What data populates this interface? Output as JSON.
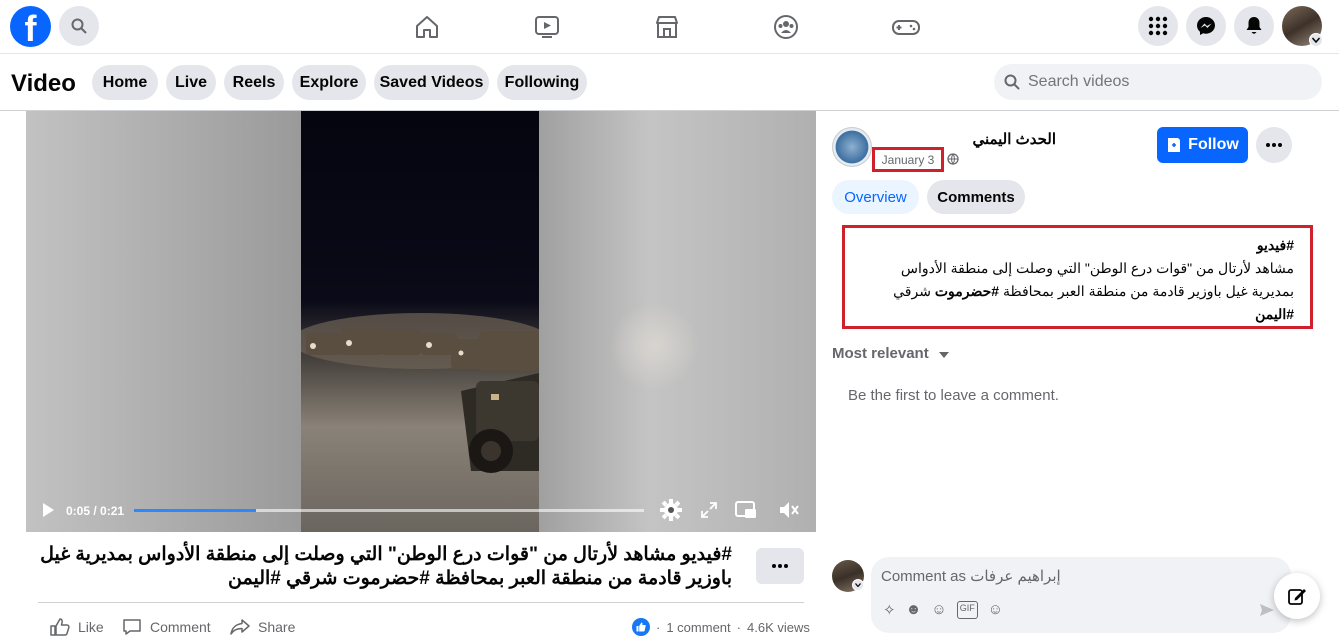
{
  "app": {
    "logo_letter": "f",
    "brand_color": "#0866ff"
  },
  "topnav": {
    "icons": [
      "home-icon",
      "watch-icon",
      "marketplace-icon",
      "groups-icon",
      "gaming-icon"
    ],
    "right_icons": [
      "menu-grid-icon",
      "messenger-icon",
      "notifications-icon",
      "profile-avatar"
    ]
  },
  "video_header": {
    "title": "Video",
    "tabs": [
      "Home",
      "Live",
      "Reels",
      "Explore",
      "Saved Videos",
      "Following"
    ],
    "search_placeholder": "Search videos"
  },
  "player": {
    "time": "0:05 / 0:21",
    "progress_fraction": 0.24
  },
  "caption": "#فيديو مشاهد لأرتال من \"قوات درع الوطن\" التي وصلت إلى منطقة الأدواس بمديرية غيل باوزير قادمة من منطقة العبر بمحافظة #حضرموت شرقي #اليمن",
  "actions": {
    "like": "Like",
    "comment": "Comment",
    "share": "Share",
    "comments_count": "1 comment",
    "views": "4.6K views"
  },
  "post": {
    "page_name": "الحدث اليمني",
    "date": "January 3",
    "follow_label": "Follow",
    "tabs": [
      "Overview",
      "Comments"
    ],
    "description_line1": "#فيديو",
    "description_line2": "مشاهد لأرتال من \"قوات درع الوطن\" التي وصلت إلى منطقة الأدواس",
    "description_line3a": "بمديرية غيل باوزير قادمة من منطقة العبر بمحافظة ",
    "description_line3b": "#حضرموت",
    "description_line3c": " شرقي",
    "description_line4": "#اليمن",
    "sort_label": "Most relevant",
    "empty_comments": "Be the first to leave a comment.",
    "comment_placeholder": "Comment as إبراهيم عرفات"
  },
  "colors": {
    "highlight_box": "#d0202c",
    "accent": "#0866ff"
  }
}
